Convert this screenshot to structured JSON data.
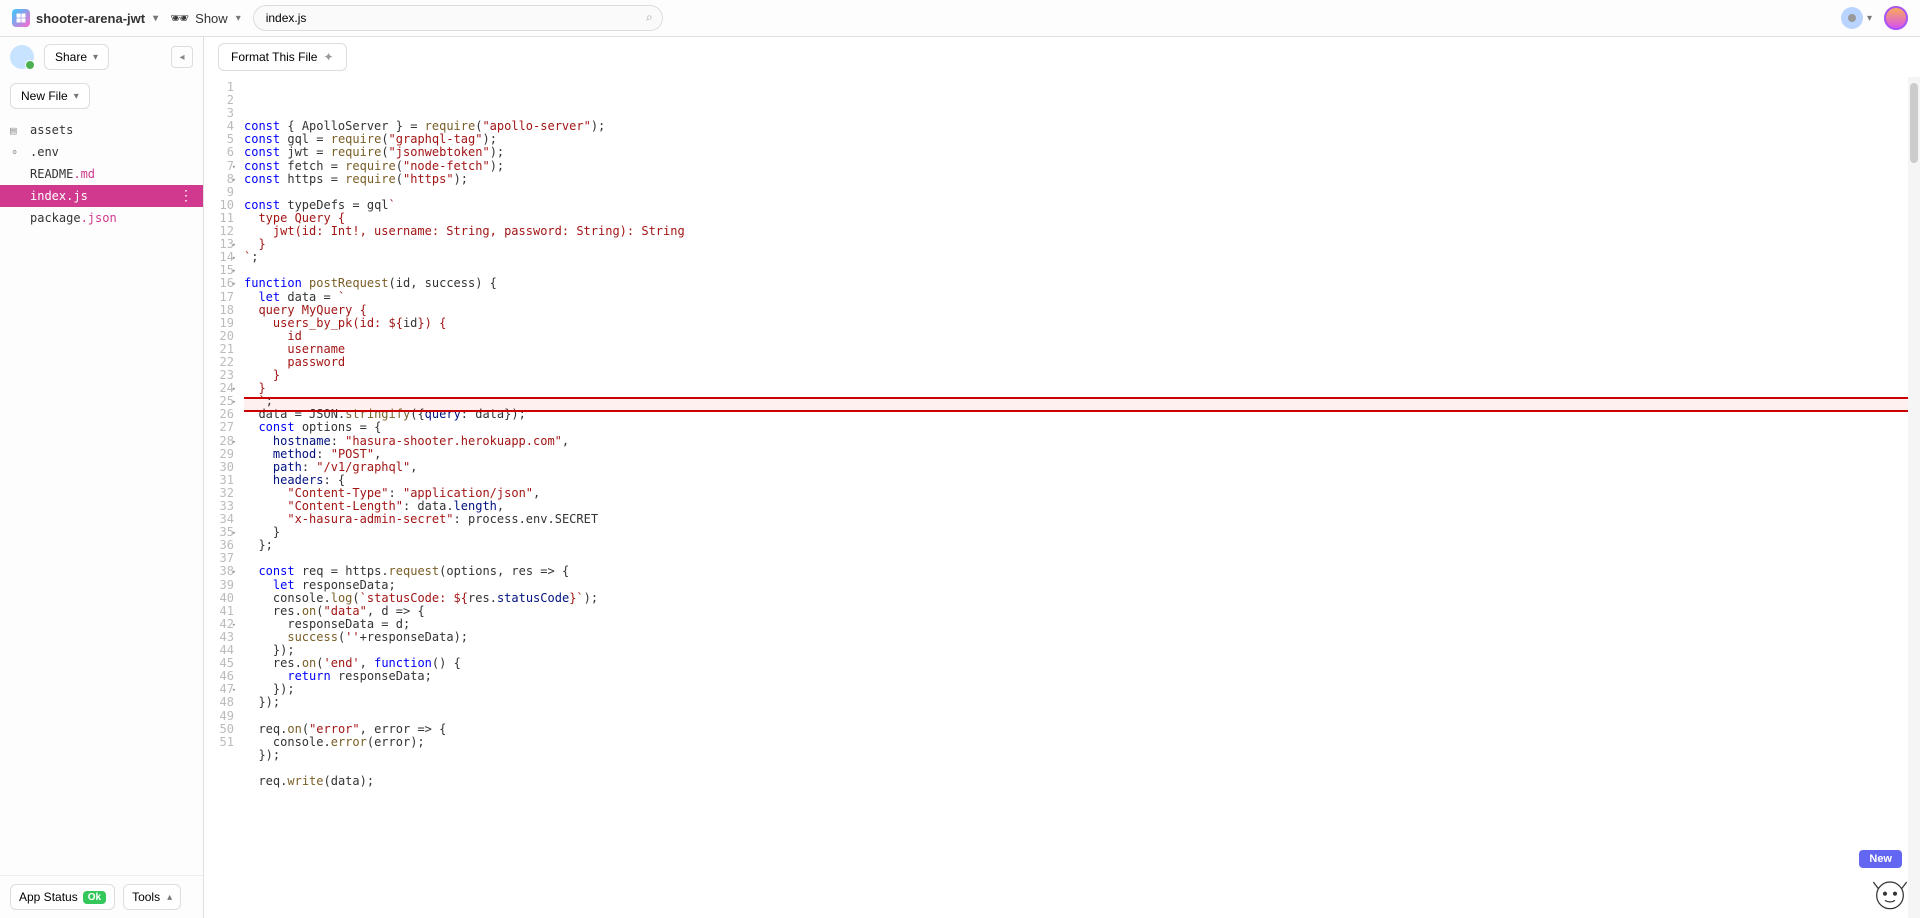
{
  "header": {
    "project_name": "shooter-arena-jwt",
    "show_label": "Show",
    "search_value": "index.js"
  },
  "sidebar": {
    "share_label": "Share",
    "newfile_label": "New File",
    "files": [
      {
        "icon": "▤",
        "name": "assets",
        "ext": ""
      },
      {
        "icon": "⚬",
        "name": ".env",
        "ext": ""
      },
      {
        "icon": "",
        "name": "README",
        "ext": ".md"
      },
      {
        "icon": "",
        "name": "index",
        "ext": ".js",
        "active": true
      },
      {
        "icon": "",
        "name": "package",
        "ext": ".json"
      }
    ],
    "app_status_label": "App Status",
    "status_value": "Ok",
    "tools_label": "Tools"
  },
  "editor": {
    "format_label": "Format This File",
    "new_label": "New",
    "highlight_line": 25,
    "line_count": 51,
    "fold_lines": [
      7,
      8,
      13,
      14,
      15,
      16,
      24,
      25,
      28,
      35,
      38,
      42,
      47
    ],
    "code": [
      [
        [
          "kw",
          "const"
        ],
        [
          "op",
          " { "
        ],
        [
          "",
          "ApolloServer"
        ],
        [
          "op",
          " } = "
        ],
        [
          "fn",
          "require"
        ],
        [
          "op",
          "("
        ],
        [
          "str",
          "\"apollo-server\""
        ],
        [
          "op",
          ");"
        ]
      ],
      [
        [
          "kw",
          "const"
        ],
        [
          "op",
          " "
        ],
        [
          "",
          "gql"
        ],
        [
          "op",
          " = "
        ],
        [
          "fn",
          "require"
        ],
        [
          "op",
          "("
        ],
        [
          "str",
          "\"graphql-tag\""
        ],
        [
          "op",
          ");"
        ]
      ],
      [
        [
          "kw",
          "const"
        ],
        [
          "op",
          " "
        ],
        [
          "",
          "jwt"
        ],
        [
          "op",
          " = "
        ],
        [
          "fn",
          "require"
        ],
        [
          "op",
          "("
        ],
        [
          "str",
          "\"jsonwebtoken\""
        ],
        [
          "op",
          ");"
        ]
      ],
      [
        [
          "kw",
          "const"
        ],
        [
          "op",
          " "
        ],
        [
          "",
          "fetch"
        ],
        [
          "op",
          " = "
        ],
        [
          "fn",
          "require"
        ],
        [
          "op",
          "("
        ],
        [
          "str",
          "\"node-fetch\""
        ],
        [
          "op",
          ");"
        ]
      ],
      [
        [
          "kw",
          "const"
        ],
        [
          "op",
          " "
        ],
        [
          "",
          "https"
        ],
        [
          "op",
          " = "
        ],
        [
          "fn",
          "require"
        ],
        [
          "op",
          "("
        ],
        [
          "str",
          "\"https\""
        ],
        [
          "op",
          ");"
        ]
      ],
      [],
      [
        [
          "kw",
          "const"
        ],
        [
          "op",
          " "
        ],
        [
          "",
          "typeDefs"
        ],
        [
          "op",
          " = "
        ],
        [
          "",
          "gql"
        ],
        [
          "str",
          "`"
        ]
      ],
      [
        [
          "str",
          "  type Query {"
        ]
      ],
      [
        [
          "str",
          "    jwt(id: Int!, username: String, password: String): String"
        ]
      ],
      [
        [
          "str",
          "  }"
        ]
      ],
      [
        [
          "str",
          "`"
        ],
        [
          "op",
          ";"
        ]
      ],
      [],
      [
        [
          "kw",
          "function"
        ],
        [
          "op",
          " "
        ],
        [
          "fn",
          "postRequest"
        ],
        [
          "op",
          "("
        ],
        [
          "",
          "id"
        ],
        [
          "op",
          ", "
        ],
        [
          "",
          "success"
        ],
        [
          "op",
          ") {"
        ]
      ],
      [
        [
          "op",
          "  "
        ],
        [
          "kw",
          "let"
        ],
        [
          "op",
          " "
        ],
        [
          "",
          "data"
        ],
        [
          "op",
          " = "
        ],
        [
          "str",
          "`"
        ]
      ],
      [
        [
          "str",
          "  query MyQuery {"
        ]
      ],
      [
        [
          "str",
          "    users_by_pk(id: ${"
        ],
        [
          "",
          "id"
        ],
        [
          "str",
          "}) {"
        ]
      ],
      [
        [
          "str",
          "      id"
        ]
      ],
      [
        [
          "str",
          "      username"
        ]
      ],
      [
        [
          "str",
          "      password"
        ]
      ],
      [
        [
          "str",
          "    }"
        ]
      ],
      [
        [
          "str",
          "  }"
        ]
      ],
      [
        [
          "str",
          "  `"
        ],
        [
          "op",
          ";"
        ]
      ],
      [
        [
          "op",
          "  "
        ],
        [
          "",
          "data"
        ],
        [
          "op",
          " = "
        ],
        [
          "",
          "JSON"
        ],
        [
          "op",
          "."
        ],
        [
          "fn",
          "stringify"
        ],
        [
          "op",
          "({"
        ],
        [
          "prop",
          "query"
        ],
        [
          "op",
          ": "
        ],
        [
          "",
          "data"
        ],
        [
          "op",
          "});"
        ]
      ],
      [
        [
          "op",
          "  "
        ],
        [
          "kw",
          "const"
        ],
        [
          "op",
          " "
        ],
        [
          "",
          "options"
        ],
        [
          "op",
          " = {"
        ]
      ],
      [
        [
          "op",
          "    "
        ],
        [
          "prop",
          "hostname"
        ],
        [
          "op",
          ": "
        ],
        [
          "str",
          "\"hasura-shooter.herokuapp.com\""
        ],
        [
          "op",
          ","
        ]
      ],
      [
        [
          "op",
          "    "
        ],
        [
          "prop",
          "method"
        ],
        [
          "op",
          ": "
        ],
        [
          "str",
          "\"POST\""
        ],
        [
          "op",
          ","
        ]
      ],
      [
        [
          "op",
          "    "
        ],
        [
          "prop",
          "path"
        ],
        [
          "op",
          ": "
        ],
        [
          "str",
          "\"/v1/graphql\""
        ],
        [
          "op",
          ","
        ]
      ],
      [
        [
          "op",
          "    "
        ],
        [
          "prop",
          "headers"
        ],
        [
          "op",
          ": {"
        ]
      ],
      [
        [
          "op",
          "      "
        ],
        [
          "str",
          "\"Content-Type\""
        ],
        [
          "op",
          ": "
        ],
        [
          "str",
          "\"application/json\""
        ],
        [
          "op",
          ","
        ]
      ],
      [
        [
          "op",
          "      "
        ],
        [
          "str",
          "\"Content-Length\""
        ],
        [
          "op",
          ": "
        ],
        [
          "",
          "data"
        ],
        [
          "op",
          "."
        ],
        [
          "prop",
          "length"
        ],
        [
          "op",
          ","
        ]
      ],
      [
        [
          "op",
          "      "
        ],
        [
          "str",
          "\"x-hasura-admin-secret\""
        ],
        [
          "op",
          ": "
        ],
        [
          "",
          "process"
        ],
        [
          "op",
          "."
        ],
        [
          "",
          "env"
        ],
        [
          "op",
          "."
        ],
        [
          "",
          "SECRET"
        ]
      ],
      [
        [
          "op",
          "    }"
        ]
      ],
      [
        [
          "op",
          "  };"
        ]
      ],
      [],
      [
        [
          "op",
          "  "
        ],
        [
          "kw",
          "const"
        ],
        [
          "op",
          " "
        ],
        [
          "",
          "req"
        ],
        [
          "op",
          " = "
        ],
        [
          "",
          "https"
        ],
        [
          "op",
          "."
        ],
        [
          "fn",
          "request"
        ],
        [
          "op",
          "("
        ],
        [
          "",
          "options"
        ],
        [
          "op",
          ", "
        ],
        [
          "",
          "res"
        ],
        [
          "op",
          " => {"
        ]
      ],
      [
        [
          "op",
          "    "
        ],
        [
          "kw",
          "let"
        ],
        [
          "op",
          " "
        ],
        [
          "",
          "responseData"
        ],
        [
          "op",
          ";"
        ]
      ],
      [
        [
          "op",
          "    "
        ],
        [
          "",
          "console"
        ],
        [
          "op",
          "."
        ],
        [
          "fn",
          "log"
        ],
        [
          "op",
          "("
        ],
        [
          "str",
          "`statusCode: ${"
        ],
        [
          "",
          "res"
        ],
        [
          "op",
          "."
        ],
        [
          "prop",
          "statusCode"
        ],
        [
          "str",
          "}`"
        ],
        [
          "op",
          ");"
        ]
      ],
      [
        [
          "op",
          "    "
        ],
        [
          "",
          "res"
        ],
        [
          "op",
          "."
        ],
        [
          "fn",
          "on"
        ],
        [
          "op",
          "("
        ],
        [
          "str",
          "\"data\""
        ],
        [
          "op",
          ", "
        ],
        [
          "",
          "d"
        ],
        [
          "op",
          " => {"
        ]
      ],
      [
        [
          "op",
          "      "
        ],
        [
          "",
          "responseData"
        ],
        [
          "op",
          " = "
        ],
        [
          "",
          "d"
        ],
        [
          "op",
          ";"
        ]
      ],
      [
        [
          "op",
          "      "
        ],
        [
          "fn",
          "success"
        ],
        [
          "op",
          "("
        ],
        [
          "str",
          "''"
        ],
        [
          "op",
          "+"
        ],
        [
          "",
          "responseData"
        ],
        [
          "op",
          ");"
        ]
      ],
      [
        [
          "op",
          "    });"
        ]
      ],
      [
        [
          "op",
          "    "
        ],
        [
          "",
          "res"
        ],
        [
          "op",
          "."
        ],
        [
          "fn",
          "on"
        ],
        [
          "op",
          "("
        ],
        [
          "str",
          "'end'"
        ],
        [
          "op",
          ", "
        ],
        [
          "kw",
          "function"
        ],
        [
          "op",
          "() {"
        ]
      ],
      [
        [
          "op",
          "      "
        ],
        [
          "kw",
          "return"
        ],
        [
          "op",
          " "
        ],
        [
          "",
          "responseData"
        ],
        [
          "op",
          ";"
        ]
      ],
      [
        [
          "op",
          "    });"
        ]
      ],
      [
        [
          "op",
          "  });"
        ]
      ],
      [],
      [
        [
          "op",
          "  "
        ],
        [
          "",
          "req"
        ],
        [
          "op",
          "."
        ],
        [
          "fn",
          "on"
        ],
        [
          "op",
          "("
        ],
        [
          "str",
          "\"error\""
        ],
        [
          "op",
          ", "
        ],
        [
          "",
          "error"
        ],
        [
          "op",
          " => {"
        ]
      ],
      [
        [
          "op",
          "    "
        ],
        [
          "",
          "console"
        ],
        [
          "op",
          "."
        ],
        [
          "fn",
          "error"
        ],
        [
          "op",
          "("
        ],
        [
          "",
          "error"
        ],
        [
          "op",
          ");"
        ]
      ],
      [
        [
          "op",
          "  });"
        ]
      ],
      [],
      [
        [
          "op",
          "  "
        ],
        [
          "",
          "req"
        ],
        [
          "op",
          "."
        ],
        [
          "fn",
          "write"
        ],
        [
          "op",
          "("
        ],
        [
          "",
          "data"
        ],
        [
          "op",
          ");"
        ]
      ]
    ]
  }
}
